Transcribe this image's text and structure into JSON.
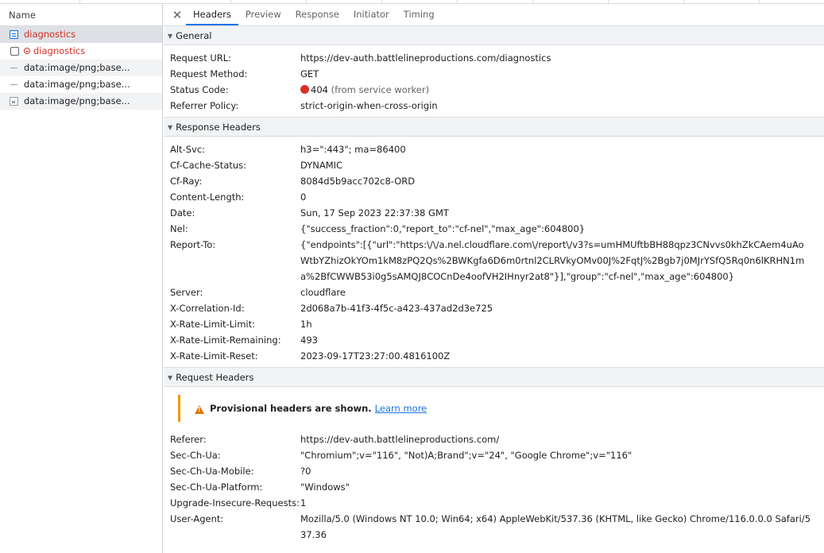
{
  "left_panel": {
    "header": "Name",
    "requests": [
      {
        "name": "diagnostics",
        "icon": "document-icon",
        "state": "selected-error"
      },
      {
        "name": "diagnostics",
        "icon": "checkbox-icon",
        "state": "error"
      },
      {
        "name": "data:image/png;base...",
        "icon": "dash-icon",
        "state": "alt"
      },
      {
        "name": "data:image/png;base...",
        "icon": "dash-icon",
        "state": "normal"
      },
      {
        "name": "data:image/png;base...",
        "icon": "image-icon",
        "state": "alt"
      }
    ]
  },
  "tabs": {
    "close": "✕",
    "items": [
      "Headers",
      "Preview",
      "Response",
      "Initiator",
      "Timing"
    ],
    "active": "Headers"
  },
  "general": {
    "title": "General",
    "request_url_label": "Request URL:",
    "request_url": "https://dev-auth.battlelineproductions.com/diagnostics",
    "method_label": "Request Method:",
    "method": "GET",
    "status_label": "Status Code:",
    "status_code": "404",
    "status_note": "(from service worker)",
    "referrer_policy_label": "Referrer Policy:",
    "referrer_policy": "strict-origin-when-cross-origin"
  },
  "response_headers": {
    "title": "Response Headers",
    "rows": [
      {
        "key": "Alt-Svc:",
        "value": "h3=\":443\"; ma=86400"
      },
      {
        "key": "Cf-Cache-Status:",
        "value": "DYNAMIC"
      },
      {
        "key": "Cf-Ray:",
        "value": "8084d5b9acc702c8-ORD"
      },
      {
        "key": "Content-Length:",
        "value": "0"
      },
      {
        "key": "Date:",
        "value": "Sun, 17 Sep 2023 22:37:38 GMT"
      },
      {
        "key": "Nel:",
        "value": "{\"success_fraction\":0,\"report_to\":\"cf-nel\",\"max_age\":604800}"
      },
      {
        "key": "Report-To:",
        "value": "{\"endpoints\":[{\"url\":\"https:\\/\\/a.nel.cloudflare.com\\/report\\/v3?s=umHMUftbBH88qpz3CNvvs0khZkCAem4uAoWtbYZhizOkYOm1kM8zPQ2Qs%2BWKgfa6D6m0rtnl2CLRVkyOMv00J%2FqtJ%2Bgb7j0MJrYSfQ5Rq0n6lKRHN1ma%2BfCWWB53i0g5sAMQJ8COCnDe4oofVH2IHnyr2at8\"}],\"group\":\"cf-nel\",\"max_age\":604800}"
      },
      {
        "key": "Server:",
        "value": "cloudflare"
      },
      {
        "key": "X-Correlation-Id:",
        "value": "2d068a7b-41f3-4f5c-a423-437ad2d3e725"
      },
      {
        "key": "X-Rate-Limit-Limit:",
        "value": "1h"
      },
      {
        "key": "X-Rate-Limit-Remaining:",
        "value": "493"
      },
      {
        "key": "X-Rate-Limit-Reset:",
        "value": "2023-09-17T23:27:00.4816100Z"
      }
    ]
  },
  "request_headers": {
    "title": "Request Headers",
    "warning_text": "Provisional headers are shown.",
    "learn_more": "Learn more",
    "rows": [
      {
        "key": "Referer:",
        "value": "https://dev-auth.battlelineproductions.com/"
      },
      {
        "key": "Sec-Ch-Ua:",
        "value": "\"Chromium\";v=\"116\", \"Not)A;Brand\";v=\"24\", \"Google Chrome\";v=\"116\""
      },
      {
        "key": "Sec-Ch-Ua-Mobile:",
        "value": "?0"
      },
      {
        "key": "Sec-Ch-Ua-Platform:",
        "value": "\"Windows\""
      },
      {
        "key": "Upgrade-Insecure-Requests:",
        "value": "1"
      },
      {
        "key": "User-Agent:",
        "value": "Mozilla/5.0 (Windows NT 10.0; Win64; x64) AppleWebKit/537.36 (KHTML, like Gecko) Chrome/116.0.0.0 Safari/537.36"
      }
    ]
  },
  "colors": {
    "error": "#d93025",
    "accent": "#1a73e8",
    "warning": "#f29900"
  }
}
